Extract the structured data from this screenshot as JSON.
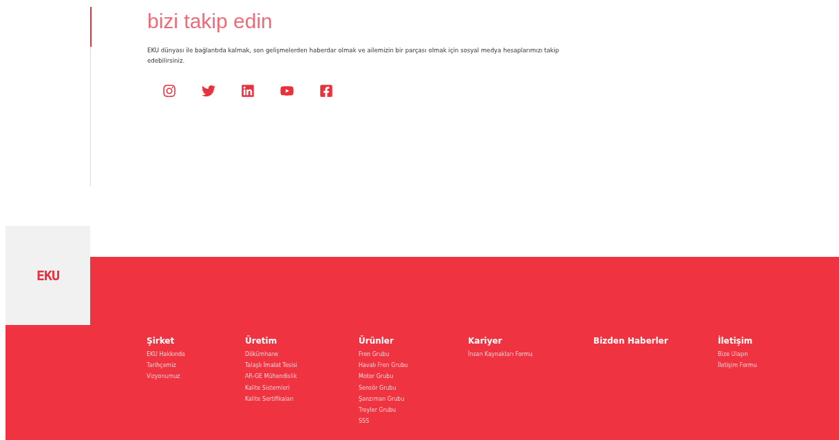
{
  "follow": {
    "title": "bizi takip edin",
    "text": "EKU dünyası ile bağlantıda kalmak, son gelişmelerden haberdar olmak ve ailemizin bir parçası olmak için sosyal medya hesaplarımızı takip edebilirsiniz.",
    "social": [
      {
        "kind": "instagram"
      },
      {
        "kind": "twitter"
      },
      {
        "kind": "linkedin"
      },
      {
        "kind": "youtube"
      },
      {
        "kind": "facebook"
      }
    ]
  },
  "footer": {
    "logo": "EKU",
    "columns": [
      {
        "title": "Şirket",
        "links": [
          "EKU Hakkında",
          "Tarihçemiz",
          "Vizyonumuz"
        ]
      },
      {
        "title": "Üretim",
        "links": [
          "Dökümhane",
          "Talaşlı İmalat Tesisi",
          "AR-GE Mühendislik",
          "Kalite Sistemleri",
          "Kalite Sertifikaları"
        ]
      },
      {
        "title": "Ürünler",
        "links": [
          "Fren Grubu",
          "Havalı Fren Grubu",
          "Motor Grubu",
          "Sensör Grubu",
          "Şanzıman Grubu",
          "Treyler Grubu",
          "SSS"
        ]
      },
      {
        "title": "Kariyer",
        "links": [
          "İnsan Kaynakları Formu"
        ]
      },
      {
        "title": "Bizden Haberler"
      },
      {
        "title": "İletişim",
        "links": [
          "Bize Ulaşın",
          "İletişim Formu"
        ]
      }
    ]
  }
}
